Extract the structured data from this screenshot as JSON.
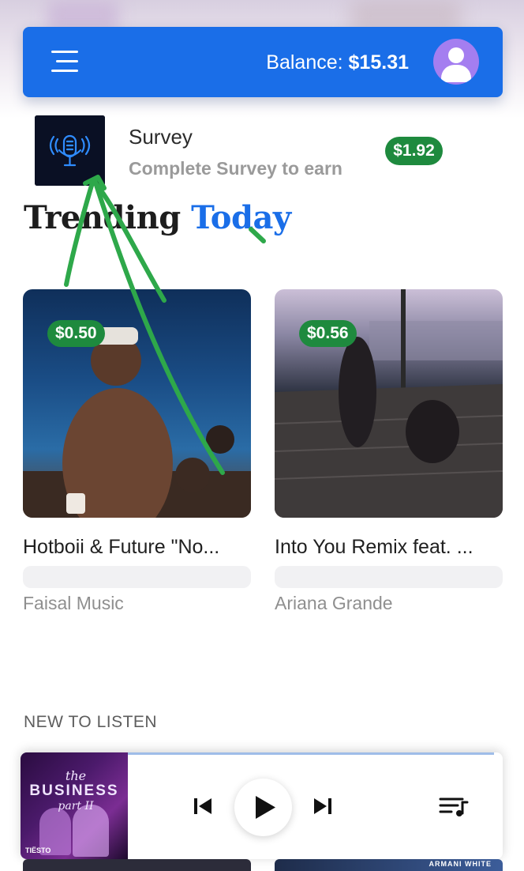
{
  "header": {
    "balance_label": "Balance:",
    "balance_value": "$15.31",
    "menu_icon": "hamburger-menu-icon",
    "avatar_icon": "user-avatar-icon",
    "color": "#1a6ee8"
  },
  "survey": {
    "title": "Survey",
    "subtitle": "Complete Survey to earn",
    "reward": "$1.92",
    "icon": "microphone-podcast-icon"
  },
  "trending": {
    "heading_part1": "Trending",
    "heading_part2": "Today",
    "accent_color": "#1a6ee8",
    "cards": [
      {
        "price": "$0.50",
        "title": "Hotboii & Future \"No...",
        "artist": "Faisal Music"
      },
      {
        "price": "$0.56",
        "title": "Into You Remix feat. ...",
        "artist": "Ariana Grande"
      }
    ]
  },
  "new_to_listen": {
    "label": "NEW TO LISTEN"
  },
  "player": {
    "art_text_1": "the",
    "art_text_2": "BUSINESS",
    "art_text_3": "part II",
    "art_tag": "TIËSTO",
    "controls": [
      "previous-track-icon",
      "play-icon",
      "next-track-icon",
      "queue-icon"
    ]
  },
  "bottom_strip": {
    "label_b": "ARMANI WHITE"
  },
  "colors": {
    "price_badge": "#1e8a3e",
    "annotation": "#2ea84a"
  }
}
